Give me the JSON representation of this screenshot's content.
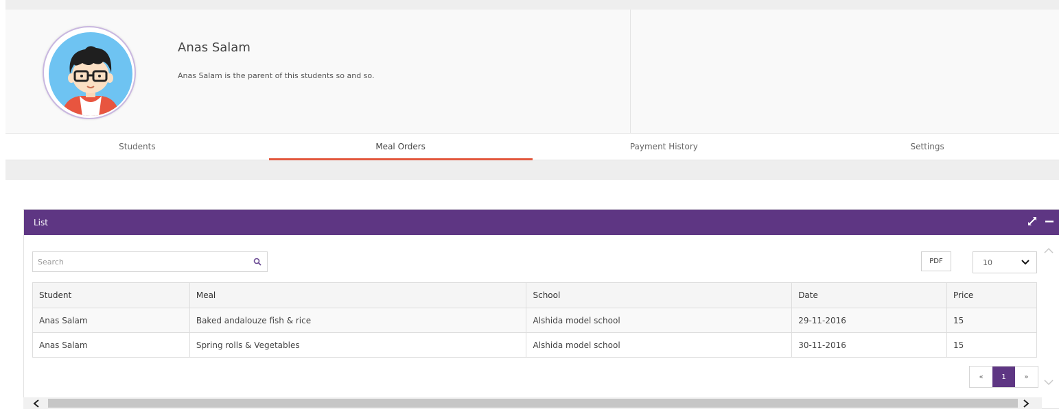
{
  "profile": {
    "name": "Anas Salam",
    "description": "Anas Salam is the parent of this students so and so."
  },
  "tabs": [
    {
      "label": "Students",
      "active": false
    },
    {
      "label": "Meal Orders",
      "active": true
    },
    {
      "label": "Payment History",
      "active": false
    },
    {
      "label": "Settings",
      "active": false
    }
  ],
  "panel": {
    "title": "List",
    "icons": [
      "expand-icon",
      "minimize-icon"
    ]
  },
  "search": {
    "placeholder": "Search",
    "value": ""
  },
  "toolbar": {
    "pdf_label": "PDF",
    "page_size": "10"
  },
  "table": {
    "headers": [
      "Student",
      "Meal",
      "School",
      "Date",
      "Price"
    ],
    "rows": [
      [
        "Anas Salam",
        "Baked andalouze fish & rice",
        "Alshida model school",
        "29-11-2016",
        "15"
      ],
      [
        "Anas Salam",
        "Spring rolls & Vegetables",
        "Alshida model school",
        "30-11-2016",
        "15"
      ]
    ]
  },
  "pagination": {
    "prev": "«",
    "current": "1",
    "next": "»"
  },
  "colors": {
    "accent": "#5e3683",
    "tab_underline": "#e2583e"
  }
}
